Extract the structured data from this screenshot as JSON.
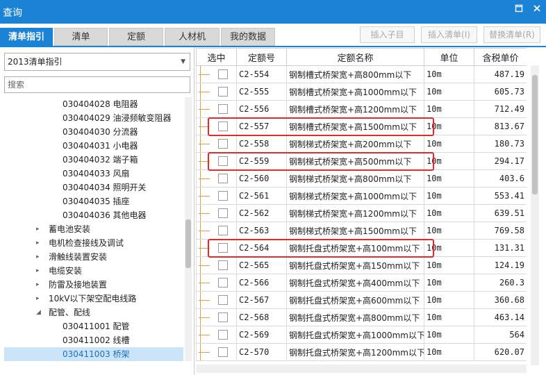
{
  "window": {
    "title": "查询",
    "restore_icon": "restore-icon",
    "close_icon": "close-icon"
  },
  "tabs": [
    {
      "label": "清单指引",
      "active": true
    },
    {
      "label": "清单",
      "active": false
    },
    {
      "label": "定额",
      "active": false
    },
    {
      "label": "人材机",
      "active": false
    },
    {
      "label": "我的数据",
      "active": false
    }
  ],
  "actions": [
    {
      "label": "插入子目"
    },
    {
      "label": "插入清单(I)"
    },
    {
      "label": "替换清单(R)"
    }
  ],
  "left": {
    "select_value": "2013清单指引",
    "search_placeholder": "搜索",
    "tree": [
      {
        "label": "030404028  电阻器",
        "indent": 2,
        "expander": "",
        "selected": false
      },
      {
        "label": "030404029  油浸频敏变阻器",
        "indent": 2,
        "expander": "",
        "selected": false
      },
      {
        "label": "030404030  分流器",
        "indent": 2,
        "expander": "",
        "selected": false
      },
      {
        "label": "030404031  小电器",
        "indent": 2,
        "expander": "",
        "selected": false
      },
      {
        "label": "030404032  端子箱",
        "indent": 2,
        "expander": "",
        "selected": false
      },
      {
        "label": "030404033  风扇",
        "indent": 2,
        "expander": "",
        "selected": false
      },
      {
        "label": "030404034  照明开关",
        "indent": 2,
        "expander": "",
        "selected": false
      },
      {
        "label": "030404035  插座",
        "indent": 2,
        "expander": "",
        "selected": false
      },
      {
        "label": "030404036  其他电器",
        "indent": 2,
        "expander": "",
        "selected": false
      },
      {
        "label": "蓄电池安装",
        "indent": 1,
        "expander": "▸",
        "selected": false
      },
      {
        "label": "电机检查接线及调试",
        "indent": 1,
        "expander": "▸",
        "selected": false
      },
      {
        "label": "滑触线装置安装",
        "indent": 1,
        "expander": "▸",
        "selected": false
      },
      {
        "label": "电缆安装",
        "indent": 1,
        "expander": "▸",
        "selected": false
      },
      {
        "label": "防雷及接地装置",
        "indent": 1,
        "expander": "▸",
        "selected": false
      },
      {
        "label": "10kV以下架空配电线路",
        "indent": 1,
        "expander": "▸",
        "selected": false
      },
      {
        "label": "配管、配线",
        "indent": 1,
        "expander": "◢",
        "selected": false
      },
      {
        "label": "030411001  配管",
        "indent": 2,
        "expander": "",
        "selected": false
      },
      {
        "label": "030411002  线槽",
        "indent": 2,
        "expander": "",
        "selected": false
      },
      {
        "label": "030411003  桥架",
        "indent": 2,
        "expander": "",
        "selected": true
      }
    ]
  },
  "grid": {
    "headers": [
      "选中",
      "定额号",
      "定额名称",
      "单位",
      "含税单价"
    ],
    "rows": [
      {
        "code": "C2-554",
        "name": "钢制槽式桥架宽+高800mm以下",
        "unit": "10m",
        "price": "487.19",
        "highlight": false
      },
      {
        "code": "C2-555",
        "name": "钢制槽式桥架宽+高1000mm以下",
        "unit": "10m",
        "price": "605.73",
        "highlight": false
      },
      {
        "code": "C2-556",
        "name": "钢制槽式桥架宽+高1200mm以下",
        "unit": "10m",
        "price": "712.49",
        "highlight": false
      },
      {
        "code": "C2-557",
        "name": "钢制槽式桥架宽+高1500mm以下",
        "unit": "10m",
        "price": "813.67",
        "highlight": true
      },
      {
        "code": "C2-558",
        "name": "钢制梯式桥架宽+高200mm以下",
        "unit": "10m",
        "price": "180.73",
        "highlight": false
      },
      {
        "code": "C2-559",
        "name": "钢制梯式桥架宽+高500mm以下",
        "unit": "10m",
        "price": "294.17",
        "highlight": true
      },
      {
        "code": "C2-560",
        "name": "钢制梯式桥架宽+高800mm以下",
        "unit": "10m",
        "price": "403.6",
        "highlight": false
      },
      {
        "code": "C2-561",
        "name": "钢制梯式桥架宽+高1000mm以下",
        "unit": "10m",
        "price": "553.41",
        "highlight": false
      },
      {
        "code": "C2-562",
        "name": "钢制梯式桥架宽+高1200mm以下",
        "unit": "10m",
        "price": "639.51",
        "highlight": false
      },
      {
        "code": "C2-563",
        "name": "钢制梯式桥架宽+高1500mm以下",
        "unit": "10m",
        "price": "769.58",
        "highlight": false
      },
      {
        "code": "C2-564",
        "name": "钢制托盘式桥架宽+高100mm以下",
        "unit": "10m",
        "price": "131.31",
        "highlight": true
      },
      {
        "code": "C2-565",
        "name": "钢制托盘式桥架宽+高150mm以下",
        "unit": "10m",
        "price": "124.19",
        "highlight": false
      },
      {
        "code": "C2-566",
        "name": "钢制托盘式桥架宽+高400mm以下",
        "unit": "10m",
        "price": "260.3",
        "highlight": false
      },
      {
        "code": "C2-567",
        "name": "钢制托盘式桥架宽+高600mm以下",
        "unit": "10m",
        "price": "360.68",
        "highlight": false
      },
      {
        "code": "C2-568",
        "name": "钢制托盘式桥架宽+高800mm以下",
        "unit": "10m",
        "price": "463.14",
        "highlight": false
      },
      {
        "code": "C2-569",
        "name": "钢制托盘式桥架宽+高1000mm以下",
        "unit": "10m",
        "price": "564",
        "highlight": false
      },
      {
        "code": "C2-570",
        "name": "钢制托盘式桥架宽+高1200mm以下",
        "unit": "10m",
        "price": "620.07",
        "highlight": false
      }
    ]
  },
  "colors": {
    "accent": "#1b83d6",
    "highlight_box": "#e8272a",
    "selected_row": "#cce4f7"
  }
}
